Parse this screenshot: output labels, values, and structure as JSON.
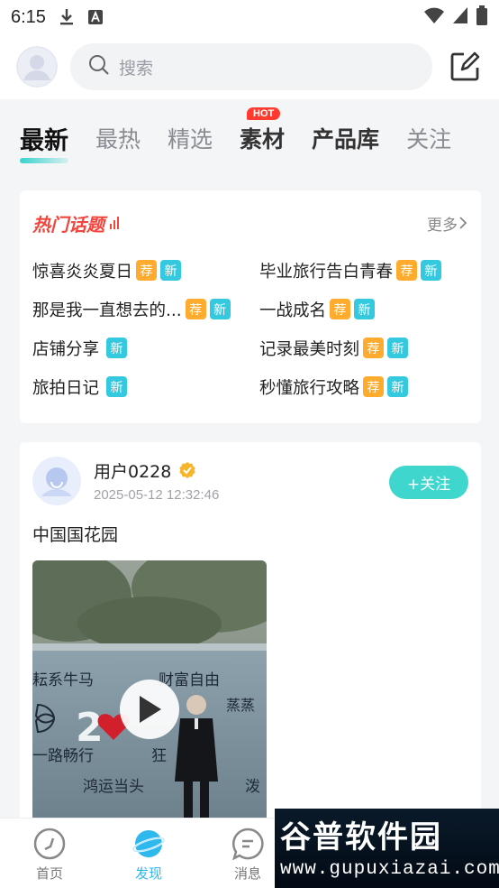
{
  "status_bar": {
    "time": "6:15"
  },
  "header": {
    "search_placeholder": "搜索"
  },
  "tabs": [
    {
      "label": "最新",
      "active": true
    },
    {
      "label": "最热"
    },
    {
      "label": "精选"
    },
    {
      "label": "素材",
      "badge": "HOT"
    },
    {
      "label": "产品库"
    },
    {
      "label": "关注"
    }
  ],
  "hot_topics": {
    "title": "热门话题",
    "more": "更多",
    "tag_rec": "荐",
    "tag_new": "新",
    "items": [
      {
        "label": "惊喜炎炎夏日",
        "rec": true,
        "new": true
      },
      {
        "label": "毕业旅行告白青春",
        "rec": true,
        "new": true
      },
      {
        "label": "那是我一直想去的...",
        "rec": true,
        "new": true
      },
      {
        "label": "一战成名",
        "rec": true,
        "new": true
      },
      {
        "label": "店铺分享",
        "rec": false,
        "new": true
      },
      {
        "label": "记录最美时刻",
        "rec": true,
        "new": true
      },
      {
        "label": "旅拍日记",
        "rec": false,
        "new": true
      },
      {
        "label": "秒懂旅行攻略",
        "rec": true,
        "new": true
      }
    ]
  },
  "post": {
    "username": "用户0228",
    "time": "2025-05-12 12:32:46",
    "follow_label": "+关注",
    "text": "中国国花园",
    "video_sign": {
      "row1a": "耘系牛马",
      "row1b": "财富自由",
      "row2": "蒸蒸",
      "row3a": "一路畅行",
      "row3b": "狂",
      "row4": "鸿运当头",
      "row4b": "泼",
      "big": "2"
    }
  },
  "bottom_nav": [
    {
      "label": "首页"
    },
    {
      "label": "发现",
      "active": true
    },
    {
      "label": "消息"
    }
  ],
  "watermark": {
    "logo": "谷普软件园",
    "url": "www.gupuxiazai.com"
  },
  "colors": {
    "accent": "#3fd6ce",
    "hot": "#f2453d",
    "rec": "#ffab2e",
    "new": "#35c9e0",
    "nav_active": "#2fb8ee"
  }
}
